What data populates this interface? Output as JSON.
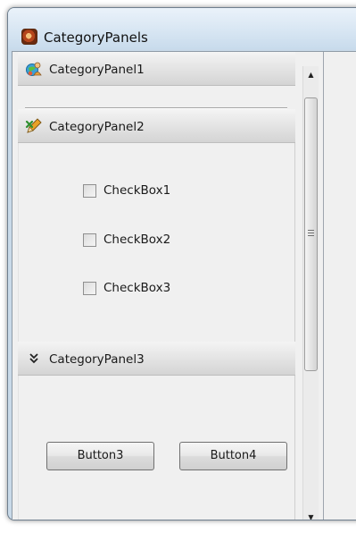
{
  "window": {
    "title": "CategoryPanels",
    "icon": "app-icon"
  },
  "panels": [
    {
      "label": "CategoryPanel1",
      "icon": "people-globe-icon",
      "collapsed": true
    },
    {
      "label": "CategoryPanel2",
      "icon": "pencil-edit-icon",
      "collapsed": false,
      "checkboxes": [
        {
          "label": "CheckBox1",
          "checked": false
        },
        {
          "label": "CheckBox2",
          "checked": false
        },
        {
          "label": "CheckBox3",
          "checked": false
        }
      ]
    },
    {
      "label": "CategoryPanel3",
      "icon": "double-chevron-down-icon",
      "collapsed": false,
      "buttons": [
        {
          "label": "Button3"
        },
        {
          "label": "Button4"
        }
      ]
    }
  ],
  "scrollbar": {
    "up_glyph": "▲",
    "down_glyph": "▼"
  }
}
